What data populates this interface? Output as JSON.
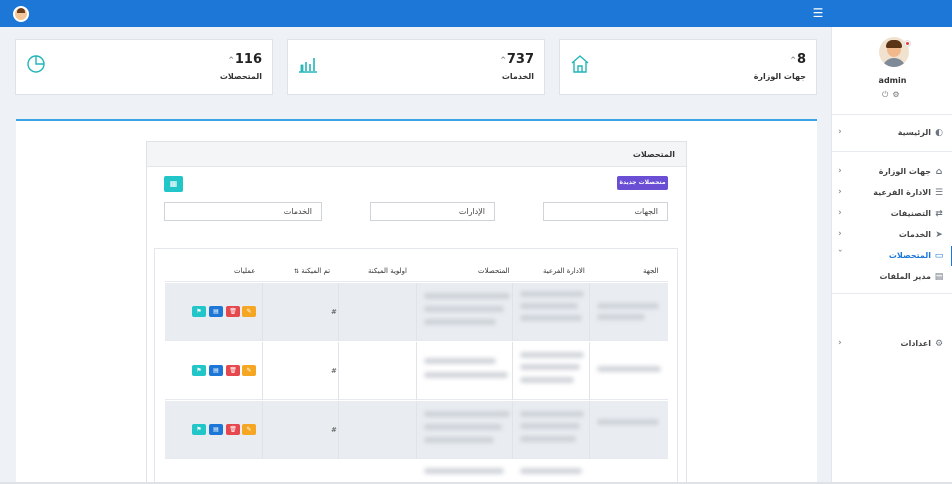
{
  "topbar": {
    "menu_icon": "hamburger-icon",
    "avatar_icon": "user-avatar-icon"
  },
  "sidebar": {
    "user": {
      "name": "admin"
    },
    "items": [
      {
        "label": "الرئيسية",
        "icon": "dashboard-icon"
      },
      {
        "label": "جهات الوزارة",
        "icon": "home-icon"
      },
      {
        "label": "الادارة الفرعية",
        "icon": "list-icon"
      },
      {
        "label": "التصنيفات",
        "icon": "shuffle-icon"
      },
      {
        "label": "الخدمات",
        "icon": "send-icon"
      },
      {
        "label": "المتحصلات",
        "icon": "card-icon",
        "active": true
      },
      {
        "label": "مدير الملفات",
        "icon": "file-icon"
      },
      {
        "label": "اعدادات",
        "icon": "gear-icon"
      }
    ]
  },
  "stats": [
    {
      "value": "8",
      "label": "جهات الوزارة",
      "icon": "home-icon"
    },
    {
      "value": "737",
      "label": "الخدمات",
      "icon": "bar-chart-icon"
    },
    {
      "value": "116",
      "label": "المتحصلات",
      "icon": "pie-chart-icon"
    }
  ],
  "panel": {
    "title": "المتحصلات",
    "new_button": "متحصلات جديدة",
    "filters": {
      "entities": "الجهات",
      "departments": "الإدارات",
      "services": "الخدمات"
    }
  },
  "table": {
    "headers": {
      "entity": "الجهة",
      "sub_department": "الادارة الفرعية",
      "collections": "المتحصلات",
      "priority": "اولوية الميكنة",
      "automated": "تم الميكنة",
      "actions": "عمليات"
    },
    "rows": [
      {
        "automated": "#"
      },
      {
        "automated": "#"
      },
      {
        "automated": "#"
      }
    ]
  },
  "colors": {
    "primary": "#1d77d6",
    "accent_teal": "#22c6c8",
    "accent_purple": "#6a4fd4",
    "danger": "#e5484d",
    "warning": "#f5a623"
  }
}
